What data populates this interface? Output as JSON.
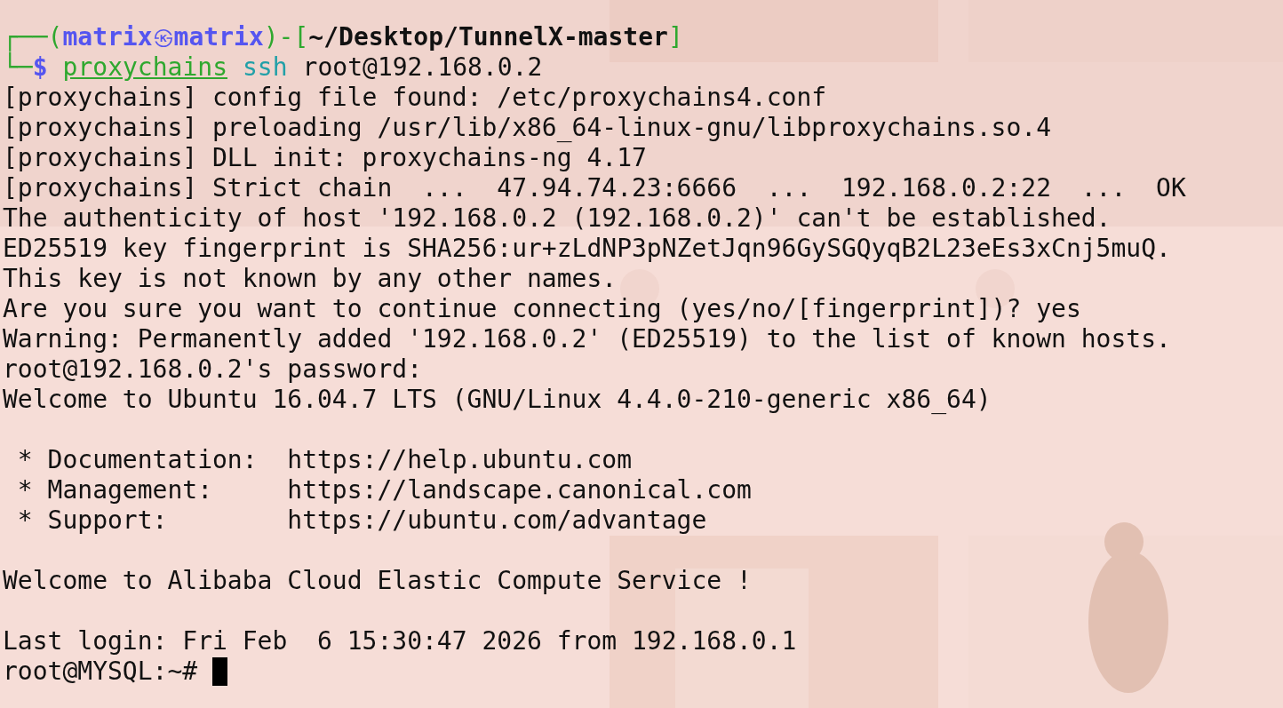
{
  "prompt": {
    "corner_top": "┌──(",
    "user": "matrix",
    "separator": "㉿",
    "host": "matrix",
    "path_open": ")-[",
    "path": "~/Desktop/TunnelX-master",
    "path_close": "]",
    "corner_bottom": "└─",
    "symbol": "$",
    "command": "proxychains",
    "subcommand": "ssh",
    "args": "root@192.168.0.2"
  },
  "output": [
    {
      "kind": "text",
      "text": "[proxychains] config file found: /etc/proxychains4.conf"
    },
    {
      "kind": "text",
      "text": "[proxychains] preloading /usr/lib/x86_64-linux-gnu/libproxychains.so.4"
    },
    {
      "kind": "text",
      "text": "[proxychains] DLL init: proxychains-ng 4.17"
    },
    {
      "kind": "text",
      "text": "[proxychains] Strict chain  ...  47.94.74.23:6666  ...  192.168.0.2:22  ...  OK"
    },
    {
      "kind": "text",
      "text": "The authenticity of host '192.168.0.2 (192.168.0.2)' can't be established."
    },
    {
      "kind": "text",
      "text": "ED25519 key fingerprint is SHA256:ur+zLdNP3pNZetJqn96GySGQyqB2L23eEs3xCnj5muQ."
    },
    {
      "kind": "text",
      "text": "This key is not known by any other names."
    },
    {
      "kind": "text",
      "text": "Are you sure you want to continue connecting (yes/no/[fingerprint])? yes"
    },
    {
      "kind": "text",
      "text": "Warning: Permanently added '192.168.0.2' (ED25519) to the list of known hosts."
    },
    {
      "kind": "text",
      "text": "root@192.168.0.2's password:"
    },
    {
      "kind": "text",
      "text": "Welcome to Ubuntu 16.04.7 LTS (GNU/Linux 4.4.0-210-generic x86_64)"
    },
    {
      "kind": "gap"
    },
    {
      "kind": "text",
      "text": " * Documentation:  https://help.ubuntu.com"
    },
    {
      "kind": "text",
      "text": " * Management:     https://landscape.canonical.com"
    },
    {
      "kind": "text",
      "text": " * Support:        https://ubuntu.com/advantage"
    },
    {
      "kind": "gap"
    },
    {
      "kind": "text",
      "text": "Welcome to Alibaba Cloud Elastic Compute Service !"
    },
    {
      "kind": "gap"
    },
    {
      "kind": "text",
      "text": "Last login: Fri Feb  6 15:30:47 2026 from 192.168.0.1"
    }
  ],
  "final_prompt": {
    "text": "root@MYSQL:~#",
    "cursor": true
  }
}
